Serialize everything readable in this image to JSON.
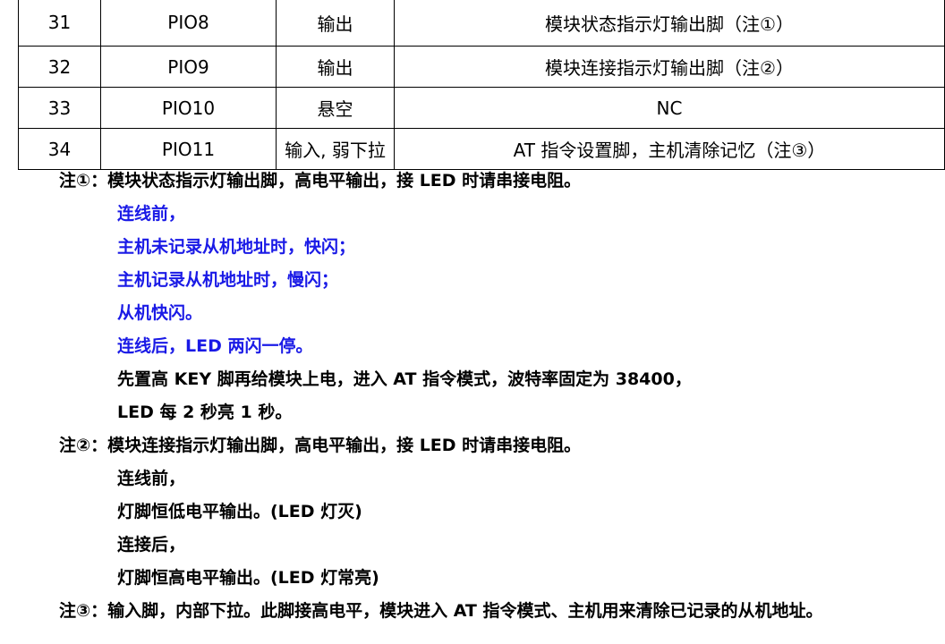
{
  "table": {
    "rows": [
      {
        "num": "31",
        "name": "PIO8",
        "type": "输出",
        "desc": "模块状态指示灯输出脚（注①）"
      },
      {
        "num": "32",
        "name": "PIO9",
        "type": "输出",
        "desc": "模块连接指示灯输出脚（注②）"
      },
      {
        "num": "33",
        "name": "PIO10",
        "type": "悬空",
        "desc": "NC"
      },
      {
        "num": "34",
        "name": "PIO11",
        "type": "输入, 弱下拉",
        "desc": "AT 指令设置脚，主机清除记忆（注③）"
      }
    ]
  },
  "notes": {
    "note1": {
      "head": "注①：模块状态指示灯输出脚，高电平输出，接 LED 时请串接电阻。",
      "lines": [
        "连线前，",
        "主机未记录从机地址时，快闪；",
        "主机记录从机地址时，慢闪；",
        "从机快闪。",
        "连线后，LED 两闪一停。"
      ],
      "extra": [
        "先置高 KEY 脚再给模块上电，进入 AT 指令模式，波特率固定为 38400，",
        "LED 每 2 秒亮 1 秒。"
      ]
    },
    "note2": {
      "head": "注②：模块连接指示灯输出脚，高电平输出，接 LED 时请串接电阻。",
      "lines": [
        "连线前，",
        "灯脚恒低电平输出。(LED 灯灭)",
        "连接后，",
        "灯脚恒高电平输出。(LED 灯常亮)"
      ]
    },
    "note3": {
      "head": "注③：输入脚，内部下拉。此脚接高电平，模块进入 AT 指令模式、主机用来清除已记录的从机地址。"
    }
  },
  "colors": {
    "highlight_text": "#1a1ae6",
    "body_text": "#000000"
  }
}
